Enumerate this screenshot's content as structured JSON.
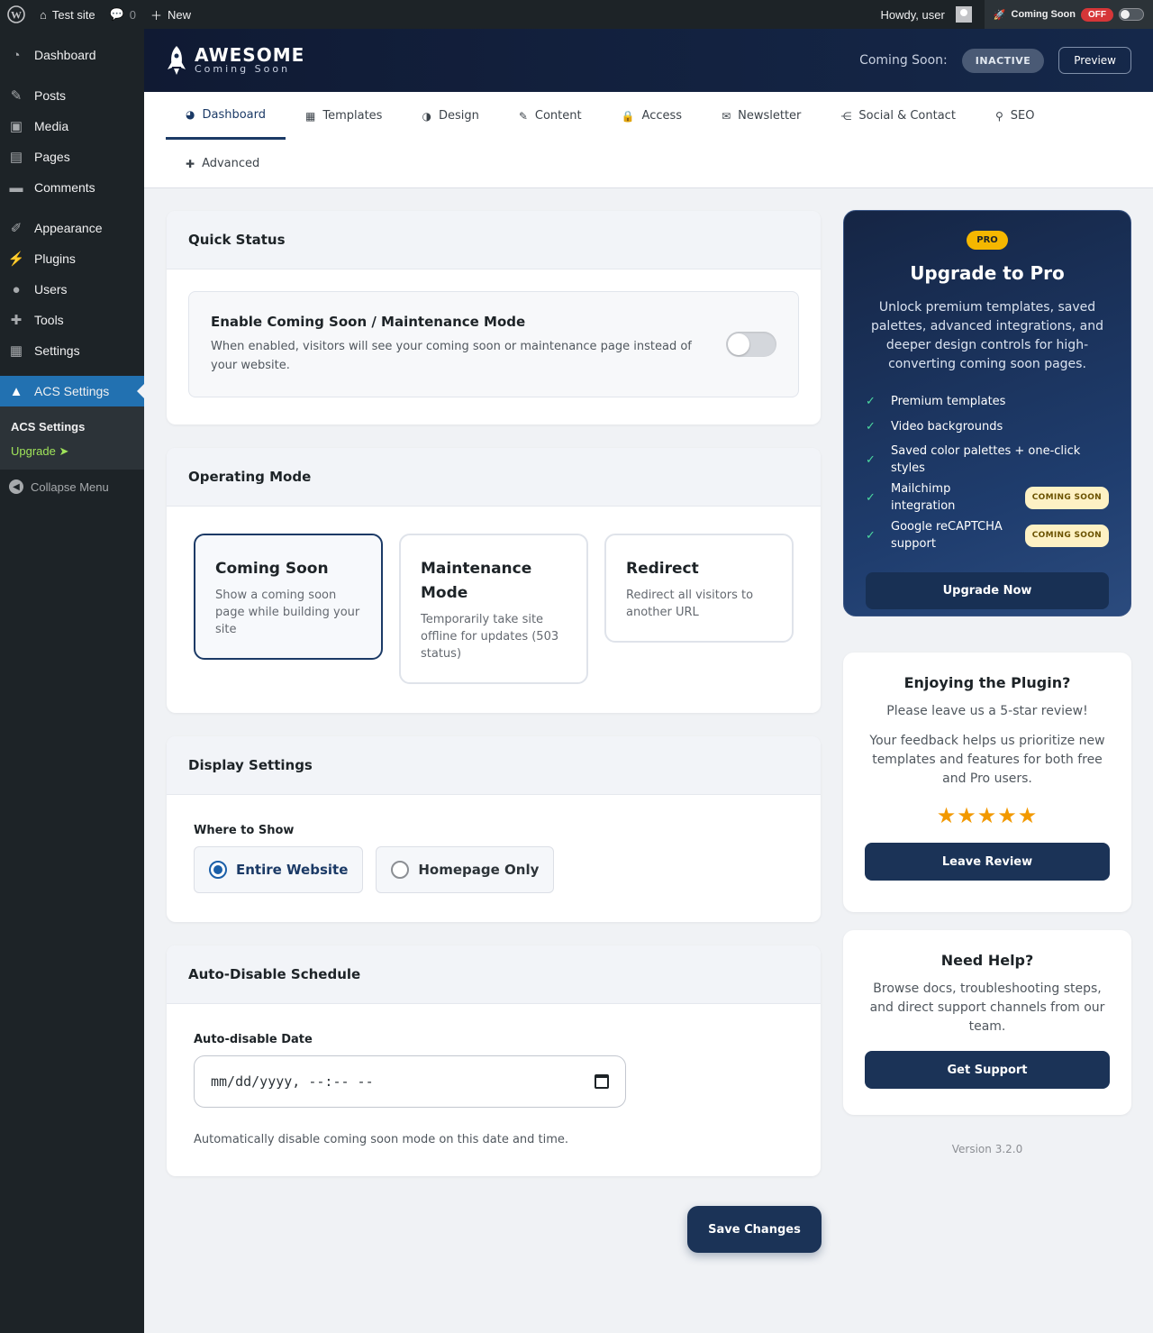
{
  "adminbar": {
    "site_name": "Test site",
    "comments_count": "0",
    "new_label": "New",
    "howdy": "Howdy, user",
    "coming_soon_label": "Coming Soon",
    "coming_soon_state": "OFF"
  },
  "sidebar": {
    "items": [
      {
        "label": "Dashboard",
        "icon": "dashboard-icon"
      },
      {
        "label": "Posts",
        "icon": "pin-icon"
      },
      {
        "label": "Media",
        "icon": "media-icon"
      },
      {
        "label": "Pages",
        "icon": "pages-icon"
      },
      {
        "label": "Comments",
        "icon": "comments-icon"
      },
      {
        "label": "Appearance",
        "icon": "brush-icon"
      },
      {
        "label": "Plugins",
        "icon": "plug-icon"
      },
      {
        "label": "Users",
        "icon": "user-icon"
      },
      {
        "label": "Tools",
        "icon": "wrench-icon"
      },
      {
        "label": "Settings",
        "icon": "settings-icon"
      },
      {
        "label": "ACS Settings",
        "icon": "rocket-icon"
      }
    ],
    "submenu": [
      "ACS Settings",
      "Upgrade ➤"
    ],
    "collapse": "Collapse Menu"
  },
  "header": {
    "logo_line1": "AWESOME",
    "logo_line2": "Coming Soon",
    "status_label": "Coming Soon:",
    "status_value": "INACTIVE",
    "preview": "Preview"
  },
  "tabs": [
    {
      "label": "Dashboard",
      "icon": "gauge-icon"
    },
    {
      "label": "Templates",
      "icon": "templates-icon"
    },
    {
      "label": "Design",
      "icon": "palette-icon"
    },
    {
      "label": "Content",
      "icon": "pencil-icon"
    },
    {
      "label": "Access",
      "icon": "lock-icon"
    },
    {
      "label": "Newsletter",
      "icon": "envelope-icon"
    },
    {
      "label": "Social & Contact",
      "icon": "share-icon"
    },
    {
      "label": "SEO",
      "icon": "search-icon"
    },
    {
      "label": "Advanced",
      "icon": "wrench-icon"
    }
  ],
  "quick_status": {
    "title": "Quick Status",
    "toggle_title": "Enable Coming Soon / Maintenance Mode",
    "toggle_desc": "When enabled, visitors will see your coming soon or maintenance page instead of your website.",
    "enabled": false
  },
  "operating_mode": {
    "title": "Operating Mode",
    "modes": [
      {
        "title": "Coming Soon",
        "desc": "Show a coming soon page while building your site",
        "selected": true
      },
      {
        "title": "Maintenance Mode",
        "desc": "Temporarily take site offline for updates (503 status)",
        "selected": false
      },
      {
        "title": "Redirect",
        "desc": "Redirect all visitors to another URL",
        "selected": false
      }
    ]
  },
  "display_settings": {
    "title": "Display Settings",
    "where_label": "Where to Show",
    "options": [
      "Entire Website",
      "Homepage Only"
    ],
    "selected": "Entire Website"
  },
  "schedule": {
    "title": "Auto-Disable Schedule",
    "date_label": "Auto-disable Date",
    "date_placeholder": "mm/dd/yyyy, --:-- --",
    "hint": "Automatically disable coming soon mode on this date and time."
  },
  "save_label": "Save Changes",
  "pro": {
    "badge": "PRO",
    "title": "Upgrade to Pro",
    "desc": "Unlock premium templates, saved palettes, advanced integrations, and deeper design controls for high-converting coming soon pages.",
    "features": [
      {
        "text": "Premium templates",
        "badge": ""
      },
      {
        "text": "Video backgrounds",
        "badge": ""
      },
      {
        "text": "Saved color palettes + one-click styles",
        "badge": ""
      },
      {
        "text": "Mailchimp integration",
        "badge": "COMING SOON"
      },
      {
        "text": "Google reCAPTCHA support",
        "badge": "COMING SOON"
      }
    ],
    "button": "Upgrade Now"
  },
  "review": {
    "title": "Enjoying the Plugin?",
    "text1": "Please leave us a 5-star review!",
    "text2": "Your feedback helps us prioritize new templates and features for both free and Pro users.",
    "stars": "★★★★★",
    "button": "Leave Review"
  },
  "help": {
    "title": "Need Help?",
    "text": "Browse docs, troubleshooting steps, and direct support channels from our team.",
    "button": "Get Support"
  },
  "version": "Version 3.2.0"
}
